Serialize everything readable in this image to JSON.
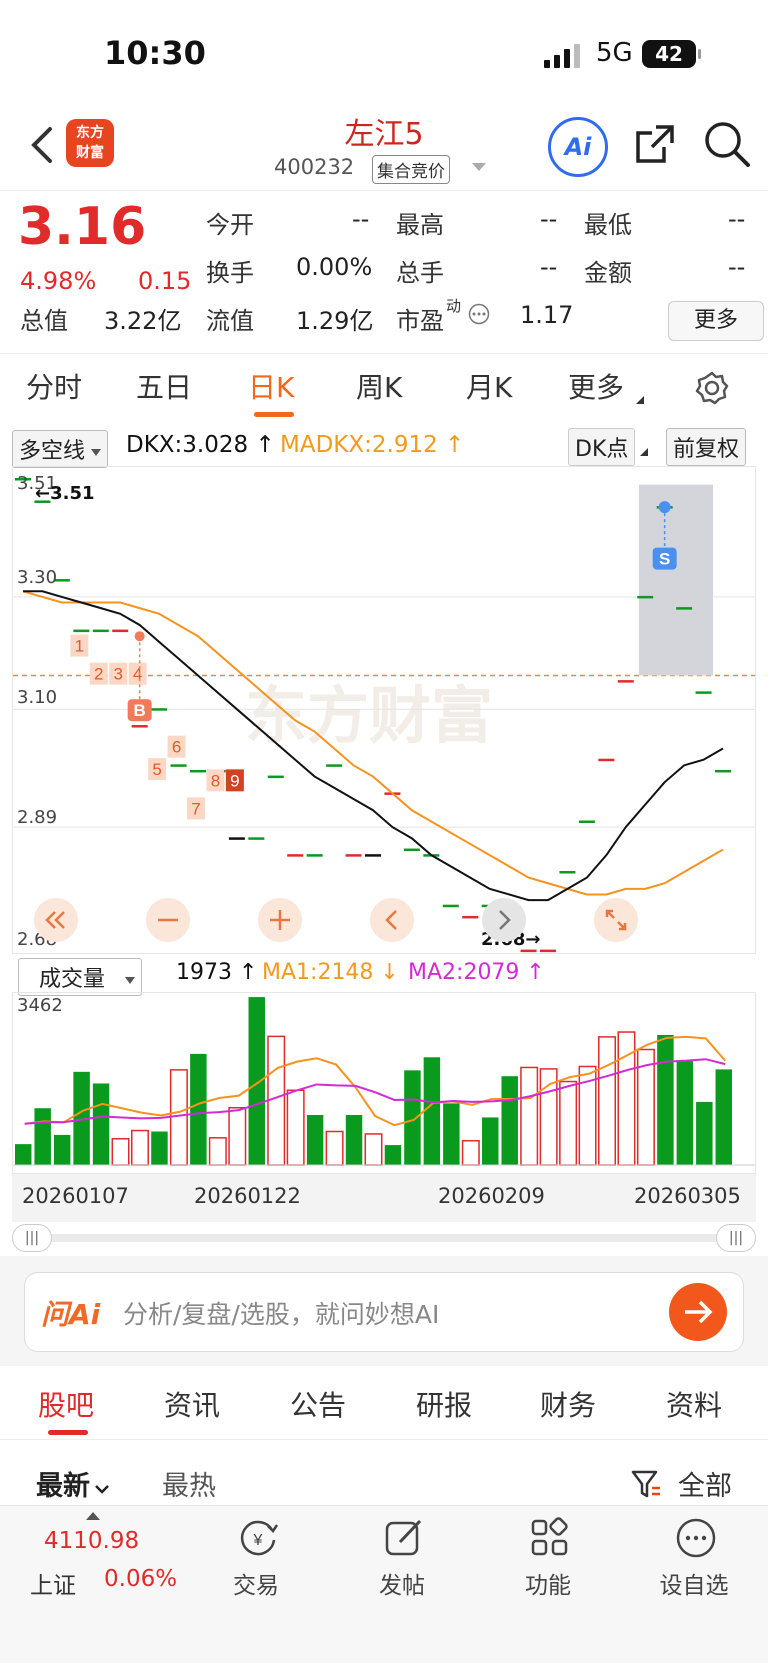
{
  "status": {
    "time": "10:30",
    "network": "5G",
    "battery": "42"
  },
  "header": {
    "logo": "东方财富",
    "name": "左江5",
    "code": "400232",
    "auction": "集合竞价"
  },
  "quote": {
    "price": "3.16",
    "pct": "4.98%",
    "chg": "0.15",
    "rows": [
      [
        {
          "l": "今开",
          "v": "--"
        },
        {
          "l": "最高",
          "v": "--"
        },
        {
          "l": "最低",
          "v": "--"
        }
      ],
      [
        {
          "l": "换手",
          "v": "0.00%"
        },
        {
          "l": "总手",
          "v": "--"
        },
        {
          "l": "金额",
          "v": "--"
        }
      ]
    ],
    "mktcap_l": "总值",
    "mktcap_v": "3.22亿",
    "float_l": "流值",
    "float_v": "1.29亿",
    "pe_l": "市盈",
    "pe_sup": "动",
    "pe_v": "1.17",
    "more": "更多"
  },
  "tabs": [
    "分时",
    "五日",
    "日K",
    "周K",
    "月K",
    "更多"
  ],
  "indicator": {
    "name": "多空线",
    "dkx": "DKX:3.028",
    "madkx": "MADKX:2.912",
    "dkpoint": "DK点",
    "adjust": "前复权"
  },
  "kline": {
    "price_labels": [
      "3.51",
      "3.30",
      "3.10",
      "2.89",
      "2.68"
    ],
    "max_label": "3.51",
    "min_label": "2.68",
    "signals": [
      "1",
      "2",
      "3",
      "4",
      "5",
      "6",
      "7",
      "8",
      "9"
    ],
    "b_label": "B",
    "s_label": "S",
    "watermark": "东方财富"
  },
  "volume": {
    "name": "成交量",
    "vol": "1973",
    "ma1": "MA1:2148",
    "ma2": "MA2:2079",
    "max": "3462"
  },
  "dates": [
    "20260107",
    "20260122",
    "20260209",
    "20260305"
  ],
  "ai": {
    "brand": "问Ai",
    "placeholder": "分析/复盘/选股，就问妙想AI"
  },
  "forum_tabs": [
    "股吧",
    "资讯",
    "公告",
    "研报",
    "财务",
    "资料"
  ],
  "sort": {
    "latest": "最新",
    "hot": "最热",
    "filter": "全部"
  },
  "bottom": {
    "index_value": "4110.98",
    "index_name": "上证",
    "index_pct": "0.06%",
    "items": [
      "交易",
      "发帖",
      "功能",
      "设自选"
    ]
  },
  "chart_data": {
    "type": "candlestick",
    "ylim": [
      2.68,
      3.51
    ],
    "candles": [
      [
        3.51,
        3.5
      ],
      [
        3.47,
        3.46
      ],
      [
        3.33,
        3.32
      ],
      [
        3.24,
        3.24
      ],
      [
        3.24,
        3.24
      ],
      [
        3.24,
        3.24
      ],
      [
        3.07,
        3.06
      ],
      [
        3.1,
        3.1
      ],
      [
        3.0,
        2.99
      ],
      [
        2.99,
        2.99
      ],
      [
        2.99,
        2.99
      ],
      [
        2.87,
        2.86
      ],
      [
        2.87,
        2.86
      ],
      [
        2.98,
        2.98
      ],
      [
        2.84,
        2.84
      ],
      [
        2.84,
        2.84
      ],
      [
        3.0,
        3.0
      ],
      [
        2.84,
        2.83
      ],
      [
        2.84,
        2.83
      ],
      [
        2.95,
        2.95
      ],
      [
        2.85,
        2.85
      ],
      [
        2.84,
        2.83
      ],
      [
        2.75,
        2.75
      ],
      [
        2.73,
        2.73
      ],
      [
        2.75,
        2.75
      ],
      [
        2.73,
        2.73
      ],
      [
        2.67,
        2.67
      ],
      [
        2.67,
        2.67
      ],
      [
        2.81,
        2.81
      ],
      [
        2.9,
        2.9
      ],
      [
        3.01,
        3.01
      ],
      [
        3.15,
        3.15
      ],
      [
        3.3,
        3.3
      ],
      [
        3.46,
        3.46
      ],
      [
        3.28,
        3.28
      ],
      [
        3.13,
        3.13
      ],
      [
        2.99,
        2.99
      ]
    ],
    "dkx": [
      3.31,
      3.31,
      3.3,
      3.29,
      3.28,
      3.27,
      3.25,
      3.22,
      3.19,
      3.16,
      3.13,
      3.1,
      3.07,
      3.04,
      3.01,
      2.98,
      2.96,
      2.94,
      2.92,
      2.89,
      2.87,
      2.84,
      2.82,
      2.8,
      2.78,
      2.77,
      2.76,
      2.76,
      2.78,
      2.8,
      2.84,
      2.89,
      2.93,
      2.97,
      3.0,
      3.01,
      3.03
    ],
    "madkx": [
      3.31,
      3.3,
      3.29,
      3.29,
      3.29,
      3.29,
      3.28,
      3.27,
      3.25,
      3.23,
      3.2,
      3.17,
      3.14,
      3.11,
      3.08,
      3.06,
      3.03,
      3.0,
      2.98,
      2.95,
      2.92,
      2.9,
      2.88,
      2.86,
      2.84,
      2.82,
      2.8,
      2.79,
      2.78,
      2.77,
      2.77,
      2.78,
      2.78,
      2.79,
      2.81,
      2.83,
      2.85
    ],
    "volume": [
      430,
      1170,
      620,
      1920,
      1680,
      540,
      710,
      690,
      1960,
      2290,
      560,
      1180,
      3460,
      2650,
      1540,
      1030,
      690,
      1030,
      640,
      410,
      1950,
      2220,
      1270,
      500,
      980,
      1830,
      2010,
      1980,
      1720,
      2030,
      2640,
      2740,
      2380,
      2680,
      2140,
      1300,
      1970
    ],
    "vol_up": [
      false,
      false,
      false,
      false,
      false,
      true,
      true,
      false,
      true,
      false,
      true,
      true,
      false,
      true,
      true,
      false,
      true,
      false,
      true,
      false,
      false,
      false,
      false,
      true,
      false,
      false,
      true,
      true,
      true,
      true,
      true,
      true,
      true,
      false,
      false,
      false,
      false
    ],
    "ma1": [
      850,
      900,
      880,
      1120,
      1260,
      1170,
      1080,
      1020,
      1100,
      1270,
      1380,
      1430,
      1700,
      2000,
      2130,
      2200,
      2070,
      1600,
      1010,
      820,
      930,
      1280,
      1310,
      1240,
      1360,
      1360,
      1380,
      1670,
      1810,
      1880,
      2060,
      2270,
      2480,
      2620,
      2640,
      2610,
      2148
    ],
    "ma2": [
      850,
      880,
      880,
      940,
      1000,
      980,
      960,
      970,
      1020,
      1070,
      1090,
      1130,
      1260,
      1400,
      1540,
      1660,
      1640,
      1630,
      1500,
      1340,
      1350,
      1290,
      1320,
      1300,
      1310,
      1340,
      1420,
      1520,
      1630,
      1730,
      1840,
      1960,
      2060,
      2130,
      2150,
      2180,
      2079
    ]
  }
}
